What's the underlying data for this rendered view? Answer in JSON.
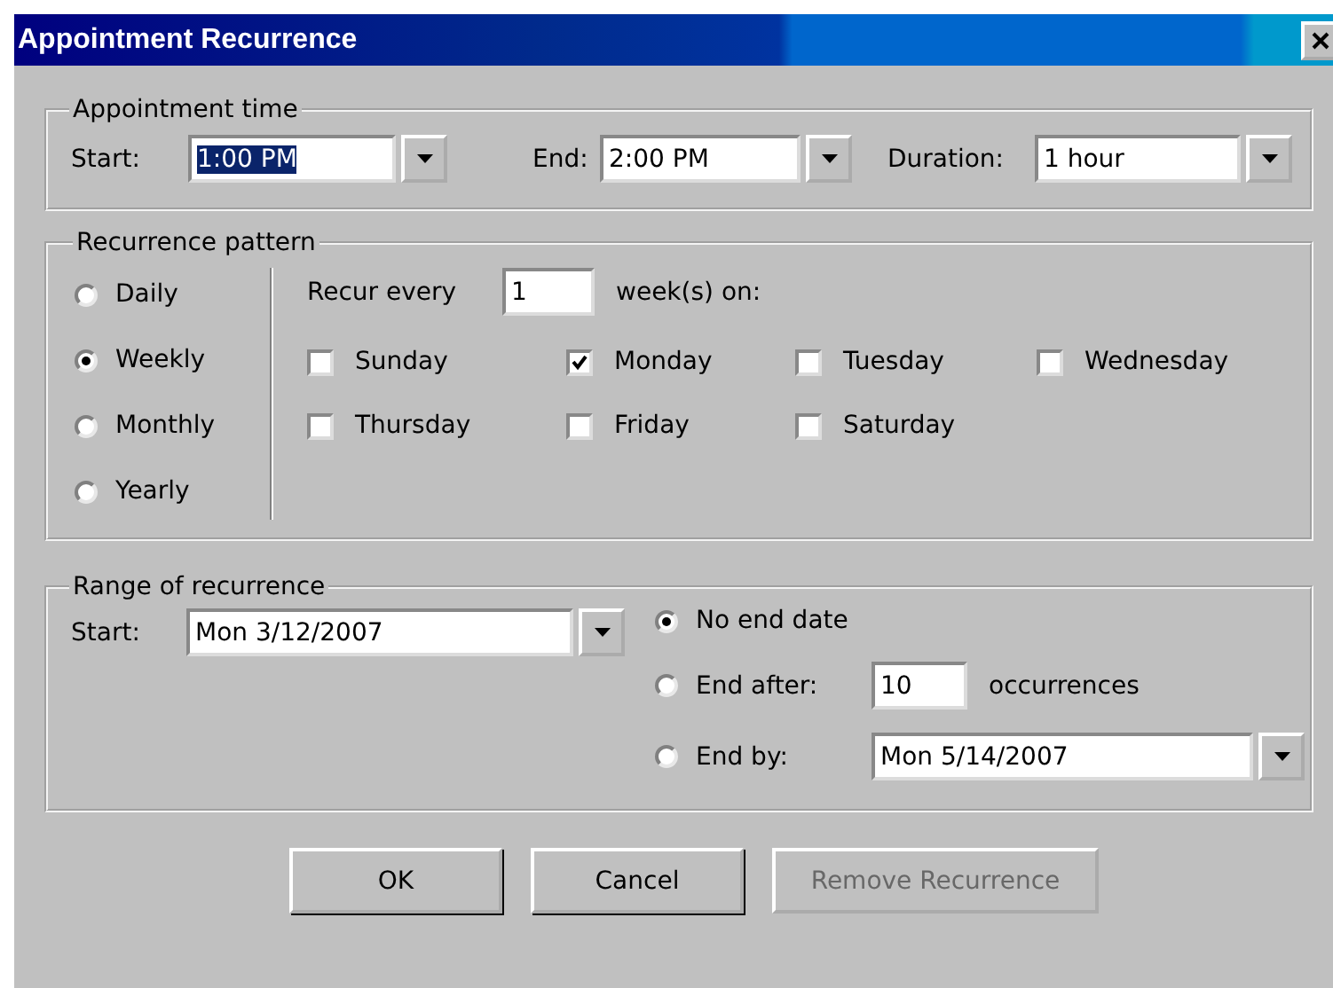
{
  "window": {
    "title": "Appointment Recurrence"
  },
  "appointment_time": {
    "title": "Appointment time",
    "fields": [
      {
        "label": "Start:",
        "value": "1:00 PM",
        "text_selected": true
      },
      {
        "label": "End:",
        "value": "2:00 PM",
        "text_selected": false
      },
      {
        "label": "Duration:",
        "value": "1 hour",
        "text_selected": false
      }
    ]
  },
  "recurrence_pattern": {
    "title": "Recurrence pattern",
    "patterns": [
      {
        "label": "Daily",
        "selected": false
      },
      {
        "label": "Weekly",
        "selected": true
      },
      {
        "label": "Monthly",
        "selected": false
      },
      {
        "label": "Yearly",
        "selected": false
      }
    ],
    "recur_every_label": "Recur every",
    "interval": "1",
    "unit_label": "week(s) on:",
    "days": [
      {
        "label": "Sunday",
        "checked": false
      },
      {
        "label": "Monday",
        "checked": true
      },
      {
        "label": "Tuesday",
        "checked": false
      },
      {
        "label": "Wednesday",
        "checked": false
      },
      {
        "label": "Thursday",
        "checked": false
      },
      {
        "label": "Friday",
        "checked": false
      },
      {
        "label": "Saturday",
        "checked": false
      }
    ]
  },
  "range_of_recurrence": {
    "title": "Range of recurrence",
    "start_label": "Start:",
    "start_value": "Mon 3/12/2007",
    "options": [
      {
        "kind": "none",
        "label": "No end date",
        "selected": true
      },
      {
        "kind": "count",
        "label": "End after:",
        "value": "10",
        "suffix": "occurrences",
        "selected": false
      },
      {
        "kind": "date",
        "label": "End by:",
        "value": "Mon 5/14/2007",
        "selected": false
      }
    ]
  },
  "buttons": [
    {
      "label": "OK",
      "disabled": false
    },
    {
      "label": "Cancel",
      "disabled": false
    },
    {
      "label": "Remove Recurrence",
      "disabled": true
    }
  ]
}
